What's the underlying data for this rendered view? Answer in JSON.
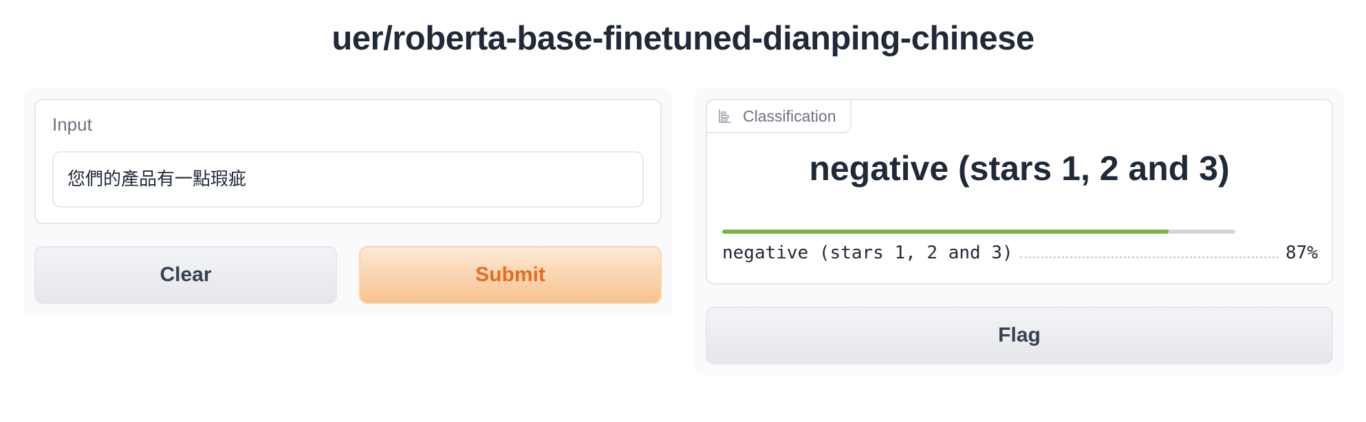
{
  "page": {
    "title": "uer/roberta-base-finetuned-dianping-chinese"
  },
  "input_panel": {
    "label": "Input",
    "textbox_value": "您們的產品有一點瑕疵",
    "clear_label": "Clear",
    "submit_label": "Submit"
  },
  "output_panel": {
    "tab_label": "Classification",
    "tab_icon": "bar-chart-icon",
    "predicted_label": "negative (stars 1, 2 and 3)",
    "confidences": [
      {
        "label": "negative (stars 1, 2 and 3)",
        "confidence": 0.87,
        "percent_text": "87%"
      }
    ],
    "flag_label": "Flag"
  },
  "colors": {
    "submit_text": "#ea6a1f",
    "bar_fill": "#7cb342",
    "bar_track": "#d1d5db"
  }
}
